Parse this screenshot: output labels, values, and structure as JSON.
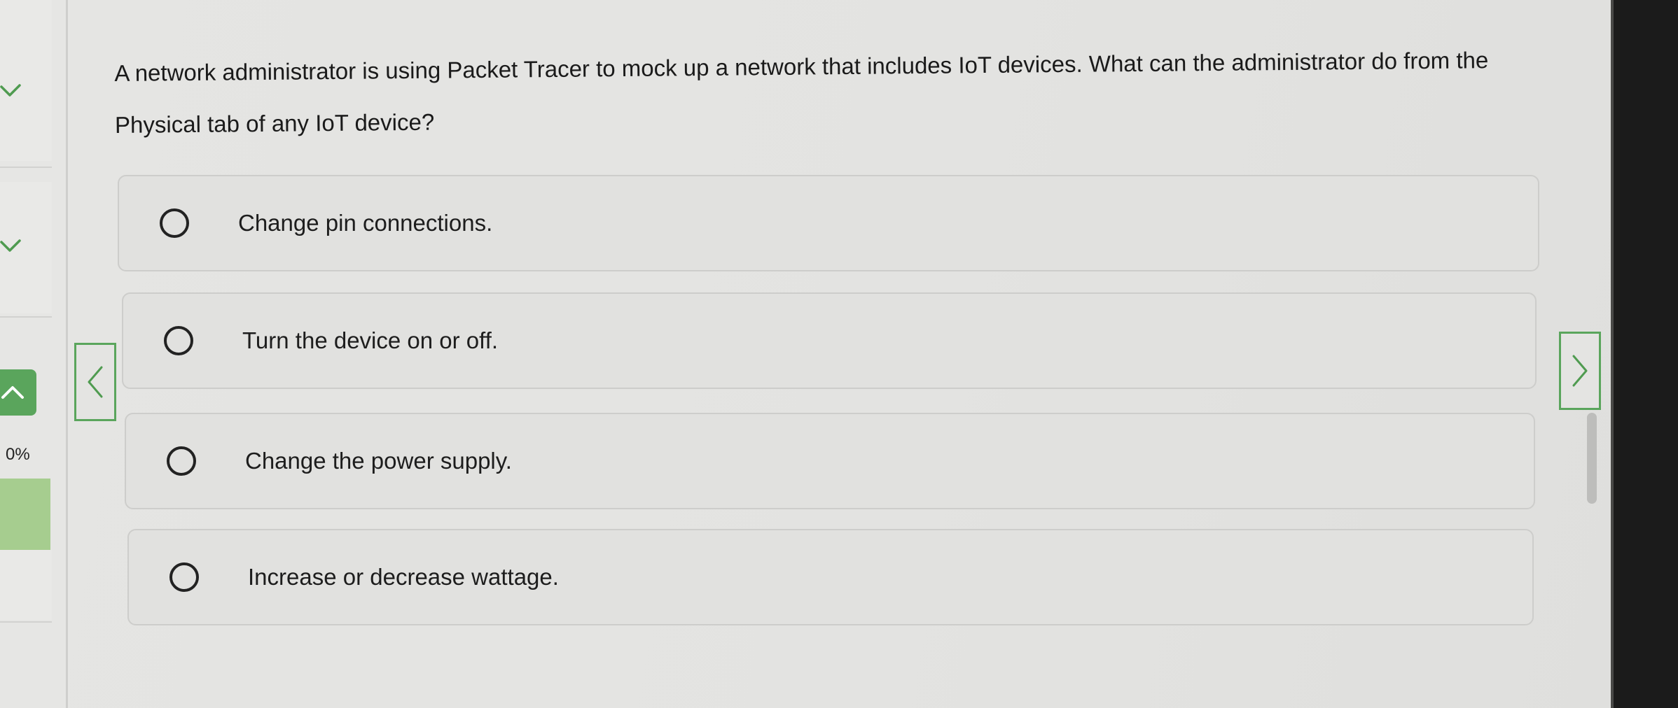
{
  "sidebar": {
    "expand_icons": [
      "chevron-down-icon",
      "chevron-down-icon"
    ],
    "collapse_icon": "chevron-up-icon",
    "progress_text": "0%",
    "progress_value": 0,
    "accent_color": "#5aa55c"
  },
  "question": {
    "text": "A network administrator is using Packet Tracer to mock up a network that includes IoT devices. What can the administrator do from the Physical tab of any IoT device?"
  },
  "options": [
    {
      "label": "Change pin connections.",
      "selected": false
    },
    {
      "label": "Turn the device on or off.",
      "selected": false
    },
    {
      "label": "Change the power supply.",
      "selected": false
    },
    {
      "label": "Increase or decrease wattage.",
      "selected": false
    }
  ],
  "navigation": {
    "prev_icon": "chevron-left-icon",
    "next_icon": "chevron-right-icon"
  }
}
